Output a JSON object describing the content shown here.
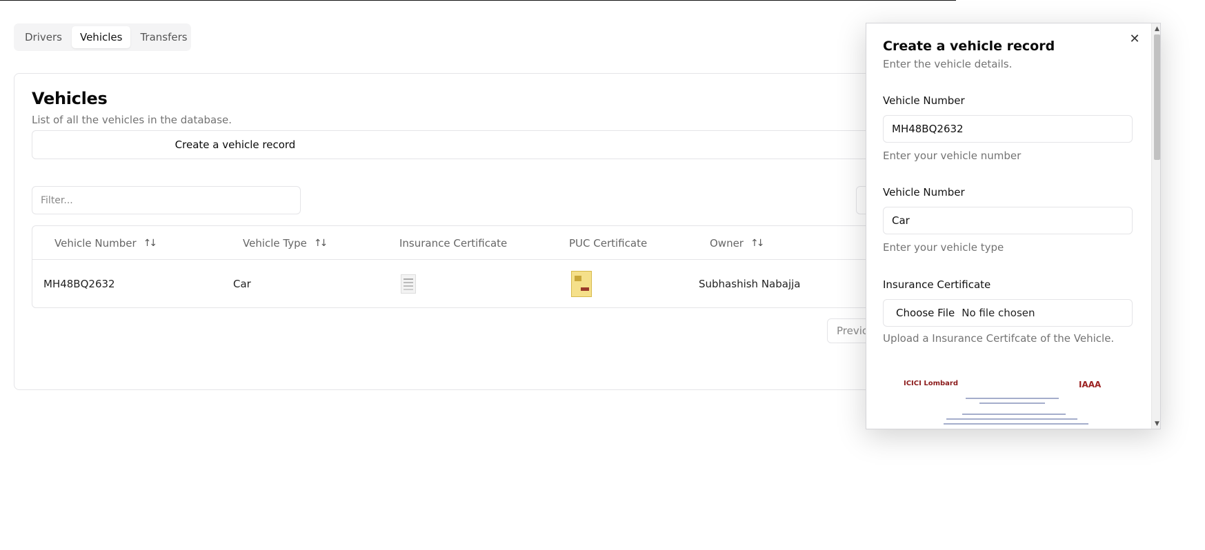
{
  "tabs": [
    {
      "label": "Drivers",
      "active": false
    },
    {
      "label": "Vehicles",
      "active": true
    },
    {
      "label": "Transfers",
      "active": false
    }
  ],
  "card": {
    "title": "Vehicles",
    "subtitle": "List of all the vehicles in the database.",
    "create_label": "Create a vehicle record",
    "filter_placeholder": "Filter..."
  },
  "table": {
    "columns": [
      {
        "label": "Vehicle Number",
        "sortable": true
      },
      {
        "label": "Vehicle Type",
        "sortable": true
      },
      {
        "label": "Insurance Certificate",
        "sortable": false
      },
      {
        "label": "PUC Certificate",
        "sortable": false
      },
      {
        "label": "Owner",
        "sortable": true
      }
    ],
    "rows": [
      {
        "vehicle_number": "MH48BQ2632",
        "vehicle_type": "Car",
        "owner": "Subhashish Nabajja"
      }
    ]
  },
  "pagination": {
    "previous_label": "Previous"
  },
  "dialog": {
    "title": "Create a vehicle record",
    "subtitle": "Enter the vehicle details.",
    "fields": {
      "vehicle_number": {
        "label": "Vehicle Number",
        "value": "MH48BQ2632",
        "help": "Enter your vehicle number"
      },
      "vehicle_type": {
        "label": "Vehicle Number",
        "value": "Car",
        "help": "Enter your vehicle type"
      },
      "insurance": {
        "label": "Insurance Certificate",
        "button": "Choose File",
        "status": "No file chosen",
        "help": "Upload a Insurance Certifcate of the Vehicle."
      }
    }
  },
  "icons": {
    "close": "close-icon",
    "sort": "sort-arrows-icon"
  },
  "colors": {
    "muted_text": "#737373",
    "border": "#e4e4e7",
    "tab_bg": "#f4f4f5"
  }
}
